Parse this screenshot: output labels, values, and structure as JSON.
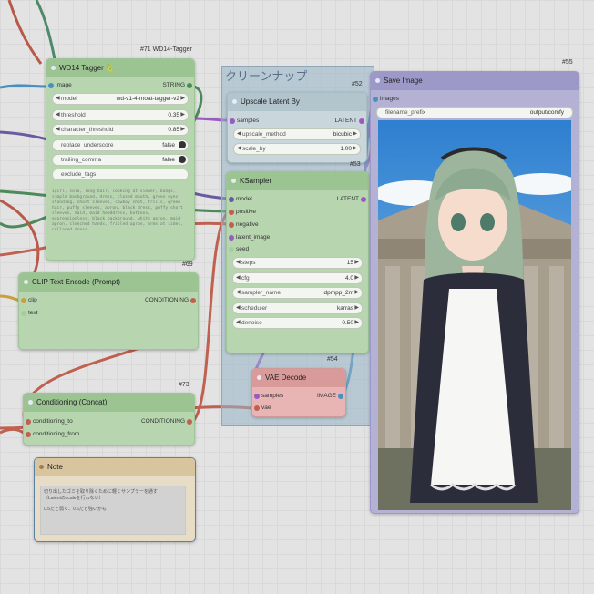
{
  "group": {
    "title": "クリーンナップ"
  },
  "tagger": {
    "id": "#71 WD14-Tagger",
    "title": "WD14 Tagger",
    "emoji": "🐍",
    "in_image": "image",
    "out_string": "STRING",
    "model_label": "model",
    "model_value": "wd-v1-4-moat-tagger-v2",
    "threshold_label": "threshold",
    "threshold_value": "0.35",
    "char_label": "character_threshold",
    "char_value": "0.85",
    "replace_label": "replace_underscore",
    "replace_value": "false",
    "trailing_label": "trailing_comma",
    "trailing_value": "false",
    "exclude_label": "exclude_tags",
    "tags": "1girl, solo, long hair, looking at viewer, bangs, simple background, dress, closed mouth, green eyes, standing, short sleeves, cowboy shot, frills, green hair, puffy sleeves, apron, black dress, puffy short sleeves, maid, maid headdress, buttons, expressionless, black background, white apron, maid apron, clenched hands, frilled apron, arms at sides, collared dress"
  },
  "clip": {
    "id": "#69",
    "title": "CLIP Text Encode (Prompt)",
    "in_clip": "clip",
    "in_text": "text",
    "out": "CONDITIONING"
  },
  "concat": {
    "id": "#73",
    "title": "Conditioning (Concat)",
    "in_to": "conditioning_to",
    "in_from": "conditioning_from",
    "out": "CONDITIONING"
  },
  "note": {
    "title": "Note",
    "line1": "切り出したゴミを取り除くために軽くサンプラーを通す",
    "line2": "（Latentのscaleを行わない）",
    "line3": "0.5だと弱く、0.6だと強いかも"
  },
  "upscale": {
    "id": "#52",
    "title": "Upscale Latent By",
    "in_samples": "samples",
    "out": "LATENT",
    "method_label": "upscale_method",
    "method_value": "bicubic",
    "scale_label": "scale_by",
    "scale_value": "1.00"
  },
  "ksampler": {
    "id": "#53",
    "title": "KSampler",
    "in_model": "model",
    "in_positive": "positive",
    "in_negative": "negative",
    "in_latent": "latent_image",
    "in_seed": "seed",
    "out": "LATENT",
    "steps_label": "steps",
    "steps_value": "15",
    "cfg_label": "cfg",
    "cfg_value": "4.0",
    "sampler_label": "sampler_name",
    "sampler_value": "dpmpp_2m",
    "scheduler_label": "scheduler",
    "scheduler_value": "karras",
    "denoise_label": "denoise",
    "denoise_value": "0.50"
  },
  "vae": {
    "id": "#54",
    "title": "VAE Decode",
    "in_samples": "samples",
    "in_vae": "vae",
    "out": "IMAGE"
  },
  "save": {
    "id": "#55",
    "title": "Save Image",
    "in_images": "images",
    "prefix_label": "filename_prefix",
    "prefix_value": "output/comfy"
  },
  "colors": {
    "node_green": "#b7d6b0",
    "header_green": "#9cc493",
    "save_bg": "#b3b1d4",
    "save_header": "#9c99c8",
    "vae_bg": "#e8b4b4",
    "vae_header": "#d99a9a",
    "note_bg": "#e7dcc5",
    "note_header": "#d8c59e",
    "group_bg": "#96b4c8"
  }
}
